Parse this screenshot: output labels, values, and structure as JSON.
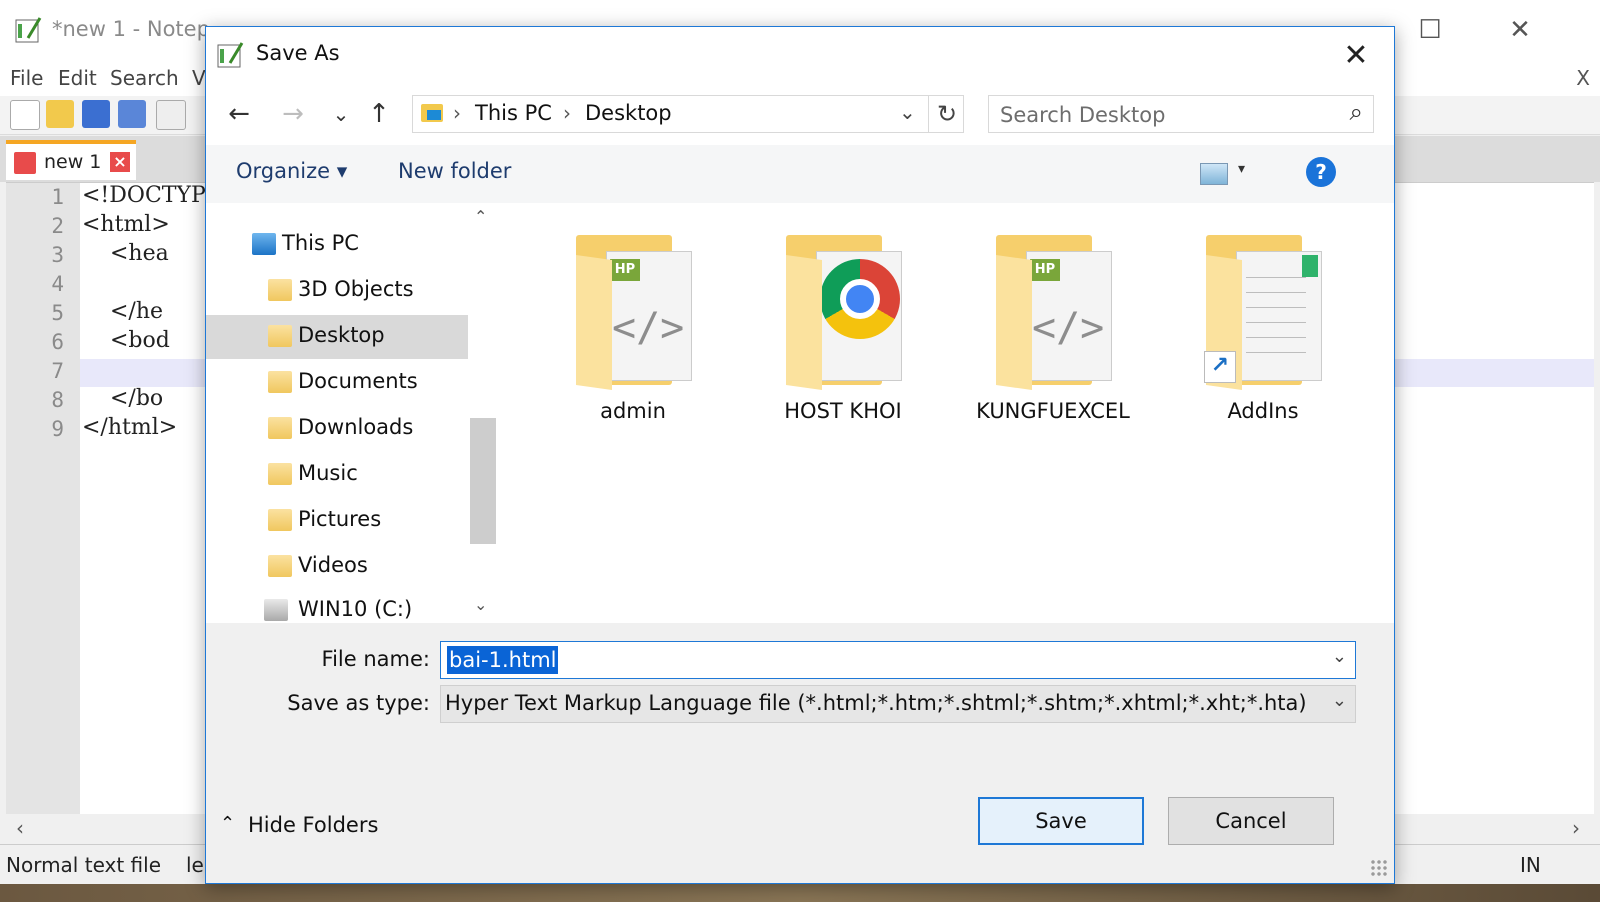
{
  "background_app": {
    "title": "*new 1 - Notep",
    "menu": [
      "File",
      "Edit",
      "Search",
      "V"
    ],
    "menu_close": "X",
    "tab_label": "new 1",
    "tab_close": "×",
    "line_numbers": [
      "1",
      "2",
      "3",
      "4",
      "5",
      "6",
      "7",
      "8",
      "9"
    ],
    "code_lines": [
      "<!DOCTYP",
      "<html>",
      "    <hea",
      "",
      "    </he",
      "    <bod",
      "",
      "    </bo",
      "</html>"
    ],
    "status_left": "Normal text file",
    "status_len": "le",
    "status_right": "IN",
    "window_controls": {
      "maximize": "☐",
      "close": "✕"
    }
  },
  "dialog": {
    "title": "Save As",
    "close_glyph": "✕",
    "nav": {
      "back": "←",
      "forward": "→",
      "recent": "⌄",
      "up": "↑"
    },
    "address": {
      "crumbs": [
        "This PC",
        "Desktop"
      ],
      "separator": "›",
      "dropdown": "⌄",
      "refresh": "↻"
    },
    "search": {
      "placeholder": "Search Desktop",
      "icon": "⌕"
    },
    "toolbar": {
      "organize": "Organize ▾",
      "new_folder": "New folder",
      "view_dropdown": "▾",
      "help": "?"
    },
    "nav_pane": {
      "items": [
        {
          "label": "This PC",
          "icon": "computer-icon"
        },
        {
          "label": "3D Objects",
          "icon": "folder-3d-icon"
        },
        {
          "label": "Desktop",
          "icon": "folder-desktop-icon",
          "selected": true
        },
        {
          "label": "Documents",
          "icon": "folder-documents-icon"
        },
        {
          "label": "Downloads",
          "icon": "folder-downloads-icon"
        },
        {
          "label": "Music",
          "icon": "folder-music-icon"
        },
        {
          "label": "Pictures",
          "icon": "folder-pictures-icon"
        },
        {
          "label": "Videos",
          "icon": "folder-videos-icon"
        },
        {
          "label": "WIN10 (C:)",
          "icon": "drive-icon"
        }
      ],
      "scroll_up": "⌃",
      "scroll_down": "⌄"
    },
    "files": [
      {
        "name": "admin",
        "icon": "folder-php-icon"
      },
      {
        "name": "HOST KHOI",
        "icon": "folder-chrome-icon"
      },
      {
        "name": "KUNGFUEXCEL",
        "icon": "folder-php-icon"
      },
      {
        "name": "AddIns",
        "icon": "folder-shortcut-icon"
      }
    ],
    "file_name_label": "File name:",
    "file_name_value": "bai-1.html",
    "save_type_label": "Save as type:",
    "save_type_value": "Hyper Text Markup Language file (*.html;*.htm;*.shtml;*.shtm;*.xhtml;*.xht;*.hta)",
    "hide_folders": "Hide Folders",
    "hide_caret": "⌃",
    "save_button": "Save",
    "cancel_button": "Cancel",
    "colors": {
      "accent": "#1e78d6",
      "selection": "#0a64d6",
      "nav_selected": "#d9d9d9"
    }
  }
}
